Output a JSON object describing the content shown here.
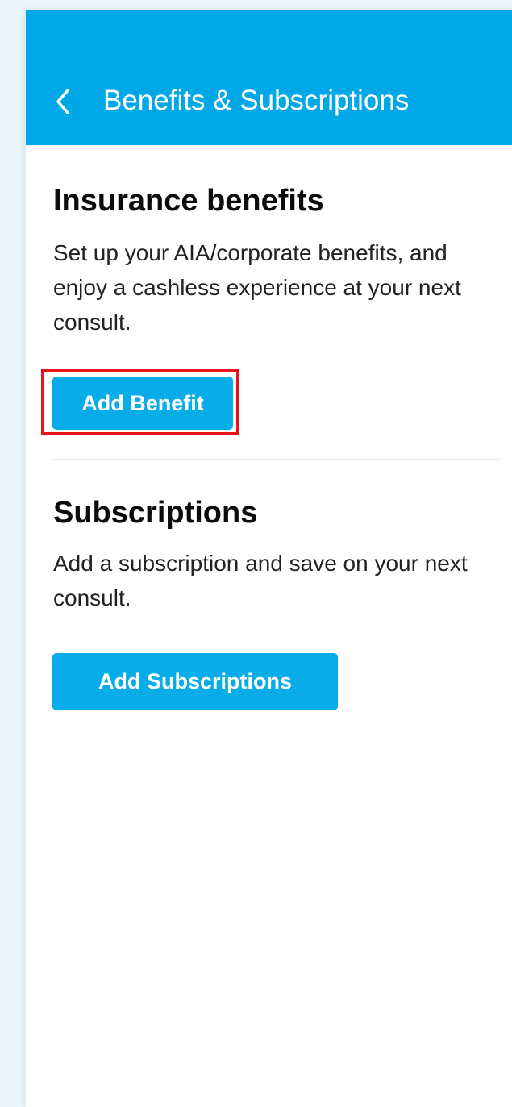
{
  "header": {
    "title": "Benefits & Subscriptions",
    "back_icon": "chevron-left-icon",
    "background_color": "#00a8e8",
    "text_color": "#ffffff"
  },
  "insurance": {
    "title": "Insurance benefits",
    "description": "Set up your AIA/corporate benefits, and enjoy a cashless experience at your next consult.",
    "button_label": "Add Benefit"
  },
  "subscriptions": {
    "title": "Subscriptions",
    "description": "Add a subscription and save on your next consult.",
    "button_label": "Add Subscriptions"
  },
  "colors": {
    "button": "#08ace8",
    "highlight": "#e8141b"
  }
}
